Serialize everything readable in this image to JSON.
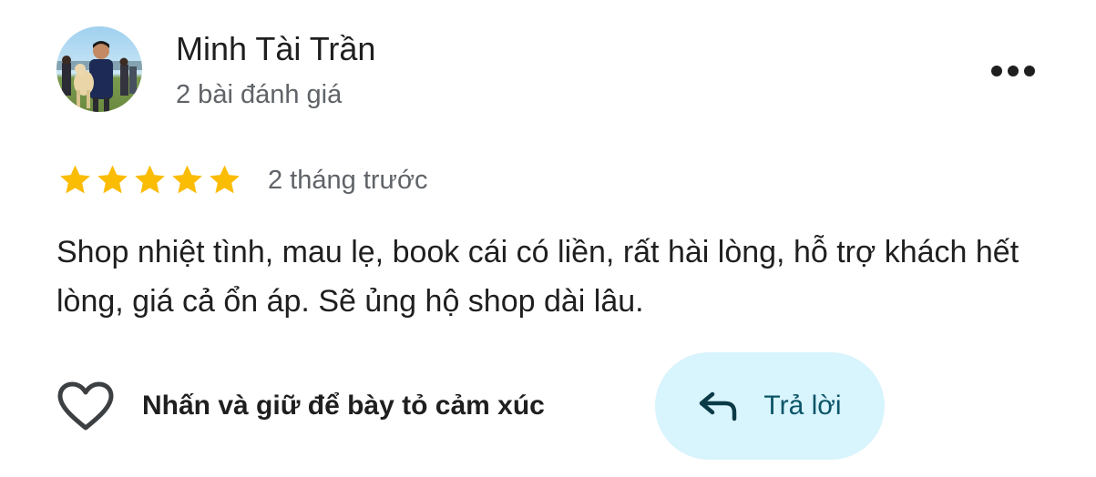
{
  "review": {
    "author": {
      "name": "Minh Tài Trần",
      "meta": "2 bài đánh giá"
    },
    "rating": 5,
    "time": "2 tháng trước",
    "text": "Shop nhiệt tình, mau lẹ, book cái có liền, rất hài lòng, hỗ trợ khách hết lòng, giá cả ổn áp. Sẽ ủng hộ shop dài lâu."
  },
  "actions": {
    "react_label": "Nhấn và giữ để bày tỏ cảm xúc",
    "reply_label": "Trả lời"
  },
  "icons": {
    "more": "more-horizontal-icon",
    "star": "star-icon",
    "heart": "heart-outline-icon",
    "reply": "reply-arrow-icon"
  },
  "colors": {
    "star": "#fbbc04",
    "secondary_text": "#5f6368",
    "primary_text": "#1f1f1f",
    "reply_bg": "#d8f4fd",
    "reply_text": "#0b5468"
  }
}
